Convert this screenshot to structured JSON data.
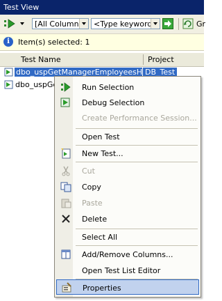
{
  "window": {
    "title": "Test View"
  },
  "toolbar": {
    "run_icon": "run-tests-icon",
    "columns_value": "[All Columns]",
    "keyword_placeholder": "<Type keyword>",
    "go_icon": "go-arrow-icon",
    "refresh_icon": "refresh-icon",
    "group_label": "Gr"
  },
  "infobar": {
    "text": "Item(s) selected: 1"
  },
  "table": {
    "headers": {
      "name": "Test Name",
      "project": "Project"
    },
    "rows": [
      {
        "name": "dbo_uspGetManagerEmployeesHasDa",
        "project": "DB_Test",
        "selected": true
      },
      {
        "name": "dbo_uspGe",
        "project": "",
        "selected": false
      }
    ]
  },
  "context_menu": {
    "items": [
      {
        "label": "Run Selection",
        "icon": "run-icon",
        "enabled": true
      },
      {
        "label": "Debug Selection",
        "icon": "debug-icon",
        "enabled": true
      },
      {
        "label": "Create Performance Session...",
        "icon": "",
        "enabled": false
      },
      {
        "label": "Open Test",
        "icon": "",
        "enabled": true
      },
      {
        "label": "New Test...",
        "icon": "new-test-icon",
        "enabled": true
      },
      {
        "label": "Cut",
        "icon": "cut-icon",
        "enabled": false
      },
      {
        "label": "Copy",
        "icon": "copy-icon",
        "enabled": true
      },
      {
        "label": "Paste",
        "icon": "paste-icon",
        "enabled": false
      },
      {
        "label": "Delete",
        "icon": "delete-icon",
        "enabled": true
      },
      {
        "label": "Select All",
        "icon": "",
        "enabled": true
      },
      {
        "label": "Add/Remove Columns...",
        "icon": "columns-icon",
        "enabled": true
      },
      {
        "label": "Open Test List Editor",
        "icon": "",
        "enabled": true
      },
      {
        "label": "Properties",
        "icon": "properties-icon",
        "enabled": true,
        "highlighted": true
      }
    ]
  },
  "colors": {
    "title_bg": "#0a246a",
    "selection": "#316ac5",
    "menu_highlight": "#c1d2ee",
    "info_bg": "#ffffe1"
  }
}
